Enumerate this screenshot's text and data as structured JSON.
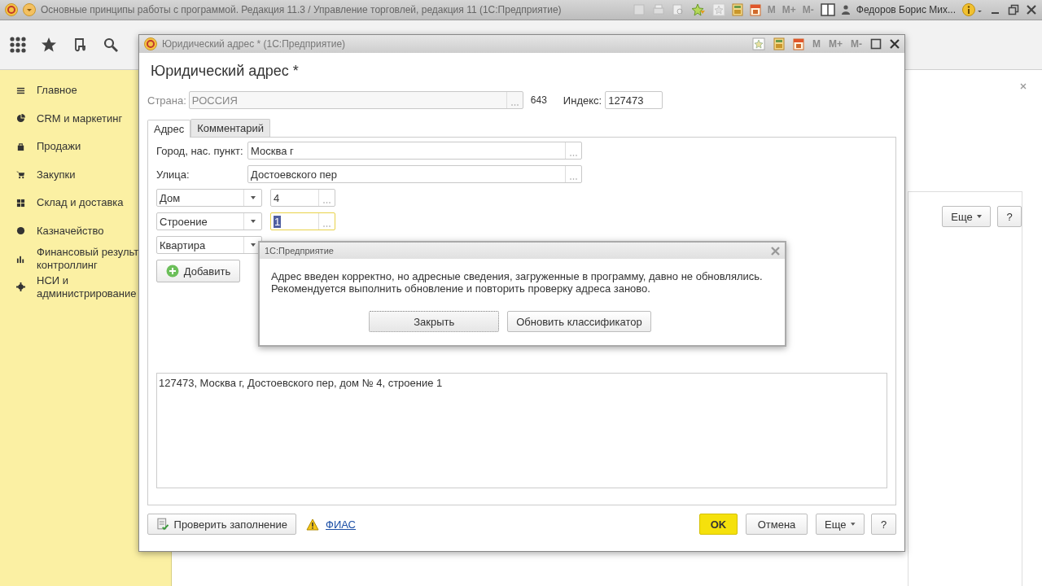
{
  "app_window": {
    "title": "Основные принципы работы с программой. Редакция 11.3 / Управление торговлей, редакция 11  (1С:Предприятие)",
    "memory_buttons": [
      "M",
      "M+",
      "M-"
    ],
    "user": "Федоров Борис Мих..."
  },
  "sidebar": {
    "items": [
      {
        "label": "Главное"
      },
      {
        "label": "CRM и маркетинг"
      },
      {
        "label": "Продажи"
      },
      {
        "label": "Закупки"
      },
      {
        "label": "Склад и доставка"
      },
      {
        "label": "Казначейство"
      },
      {
        "label": "Финансовый результ\nконтроллинг"
      },
      {
        "label": "НСИ и\nадминистрирование"
      }
    ]
  },
  "content": {
    "more_button": "Еще",
    "help_button": "?"
  },
  "form_window": {
    "title": "Юридический адрес *  (1С:Предприятие)",
    "memory_buttons": [
      "M",
      "M+",
      "M-"
    ],
    "heading": "Юридический адрес *",
    "country": {
      "label": "Страна:",
      "value": "РОССИЯ",
      "disabled": true
    },
    "country_code": "643",
    "index": {
      "label": "Индекс:",
      "value": "127473"
    },
    "tabs": [
      {
        "label": "Адрес",
        "selected": true
      },
      {
        "label": "Комментарий",
        "selected": false
      }
    ],
    "city": {
      "label": "Город, нас. пункт:",
      "value": "Москва г"
    },
    "street": {
      "label": "Улица:",
      "value": "Достоевского пер"
    },
    "parts": [
      {
        "type": "Дом",
        "value": "4",
        "focused": false
      },
      {
        "type": "Строение",
        "value": "1",
        "focused": true
      },
      {
        "type": "Квартира"
      }
    ],
    "add_button": "Добавить",
    "address_text": "127473, Москва г, Достоевского пер, дом № 4, строение 1",
    "check_button": "Проверить заполнение",
    "fias_link": "ФИАС",
    "ok_button": "OK",
    "cancel_button": "Отмена",
    "more_button": "Еще",
    "help_button": "?"
  },
  "message_dialog": {
    "title": "1С:Предприятие",
    "message": "Адрес введен корректно, но адресные сведения, загруженные в программу, давно не обновлялись.\nРекомендуется выполнить обновление и повторить проверку адреса заново.",
    "buttons": [
      {
        "label": "Закрыть",
        "default": true
      },
      {
        "label": "Обновить классификатор",
        "default": false
      }
    ]
  }
}
